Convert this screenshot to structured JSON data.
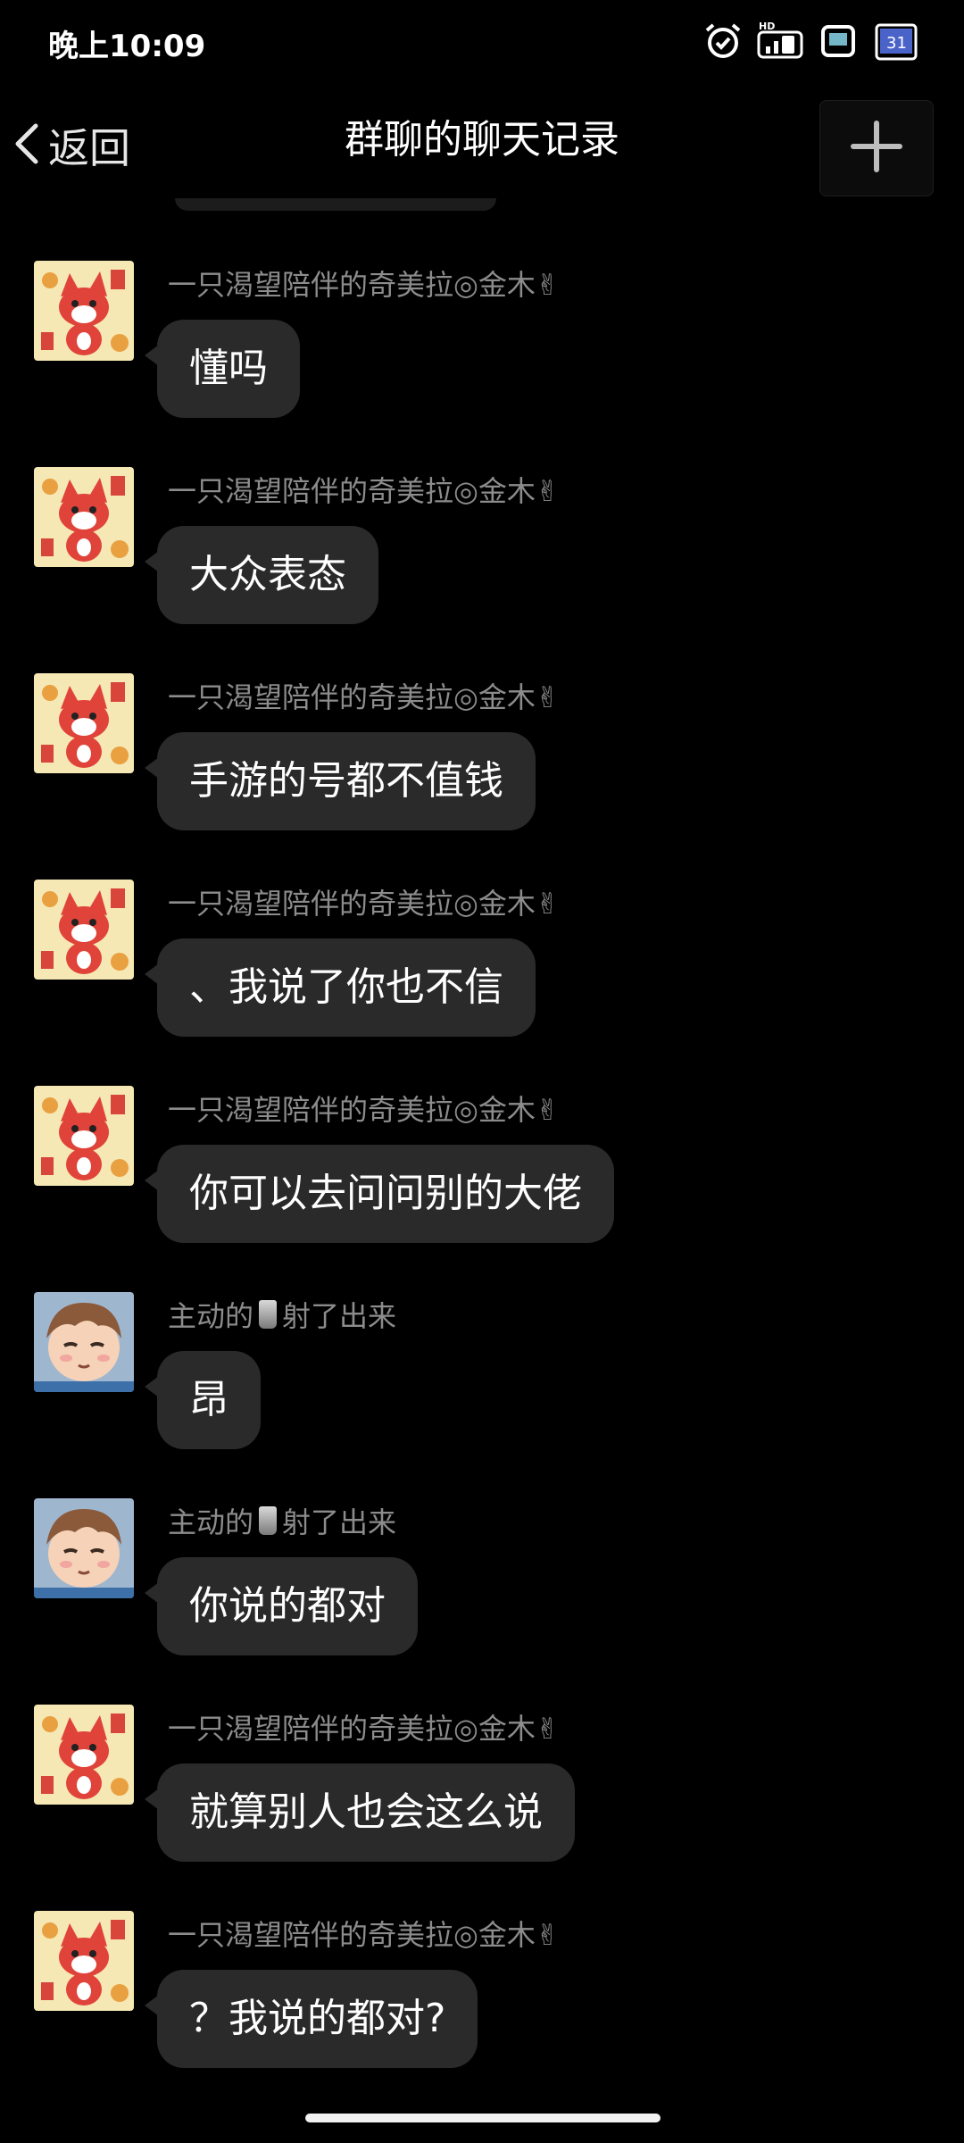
{
  "status_bar": {
    "time": "晚上10:09",
    "icons": [
      "alarm-icon",
      "hd-signal-icon",
      "sim-icon",
      "calendar-icon"
    ],
    "calendar_day": "31",
    "hd_label": "HD"
  },
  "header": {
    "back_label": "返回",
    "title": "群聊的聊天记录",
    "add_icon": "plus-icon"
  },
  "messages": [
    {
      "sender": "一只渴望陪伴的奇美拉◎金木✌",
      "text": "懂吗",
      "avatar": "red-fox-avatar"
    },
    {
      "sender": "一只渴望陪伴的奇美拉◎金木✌",
      "text": "大众表态",
      "avatar": "red-fox-avatar"
    },
    {
      "sender": "一只渴望陪伴的奇美拉◎金木✌",
      "text": "手游的号都不值钱",
      "avatar": "red-fox-avatar"
    },
    {
      "sender": "一只渴望陪伴的奇美拉◎金木✌",
      "text": "、我说了你也不信",
      "avatar": "red-fox-avatar"
    },
    {
      "sender": "一只渴望陪伴的奇美拉◎金木✌",
      "text": "你可以去问问别的大佬",
      "avatar": "red-fox-avatar"
    },
    {
      "sender_prefix": "主动的",
      "sender_suffix": "射了出来",
      "text": "昂",
      "avatar": "anime-boy-avatar"
    },
    {
      "sender_prefix": "主动的",
      "sender_suffix": "射了出来",
      "text": "你说的都对",
      "avatar": "anime-boy-avatar"
    },
    {
      "sender": "一只渴望陪伴的奇美拉◎金木✌",
      "text": "就算别人也会这么说",
      "avatar": "red-fox-avatar"
    },
    {
      "sender": "一只渴望陪伴的奇美拉◎金木✌",
      "text": "？我说的都对?",
      "avatar": "red-fox-avatar"
    }
  ],
  "colors": {
    "background": "#000000",
    "bubble": "#2a2a2a",
    "sender_text": "#8c8c8c",
    "message_text": "#ffffff"
  }
}
